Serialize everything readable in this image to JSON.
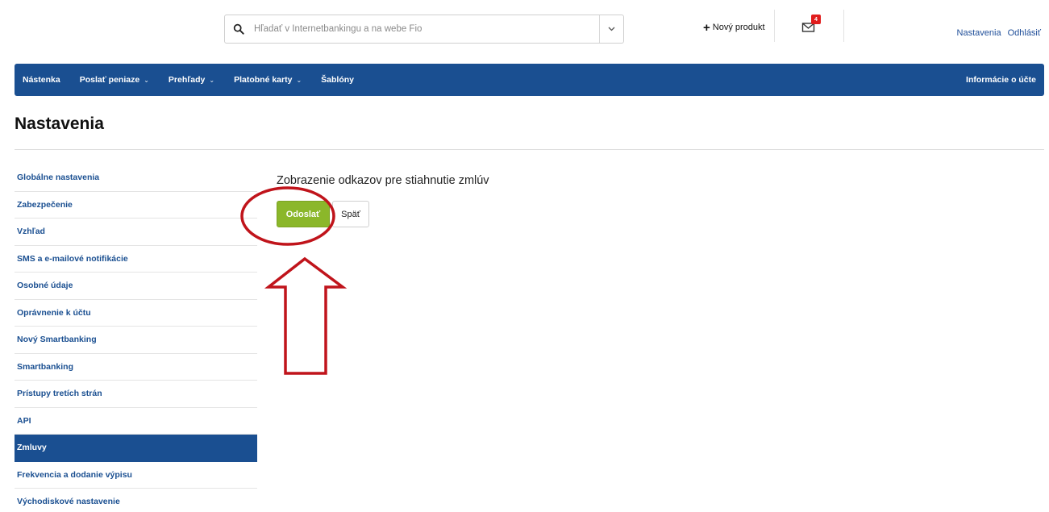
{
  "header": {
    "search": {
      "placeholder": "Hľadať v Internetbankingu a na webe Fio",
      "value": ""
    },
    "new_product": "Nový produkt",
    "messages_badge": "4",
    "links": {
      "settings": "Nastavenia",
      "logout": "Odhlásiť"
    }
  },
  "nav": {
    "items": [
      {
        "label": "Nástenka",
        "dropdown": false
      },
      {
        "label": "Poslať peniaze",
        "dropdown": true
      },
      {
        "label": "Prehľady",
        "dropdown": true
      },
      {
        "label": "Platobné karty",
        "dropdown": true
      },
      {
        "label": "Šablóny",
        "dropdown": false
      }
    ],
    "right": "Informácie o účte",
    "chevron": "⌄"
  },
  "page": {
    "title": "Nastavenia"
  },
  "sidebar": {
    "items": [
      "Globálne nastavenia",
      "Zabezpečenie",
      "Vzhľad",
      "SMS a e-mailové notifikácie",
      "Osobné údaje",
      "Oprávnenie k účtu",
      "Nový Smartbanking",
      "Smartbanking",
      "Prístupy tretích strán",
      "API",
      "Zmluvy",
      "Frekvencia a dodanie výpisu",
      "Východiskové nastavenie"
    ],
    "active_index": 10
  },
  "content": {
    "heading": "Zobrazenie odkazov pre stiahnutie zmlúv",
    "send_label": "Odoslať",
    "back_label": "Späť"
  },
  "colors": {
    "brand_blue": "#1a4f91",
    "send_green": "#8bb72a",
    "annotation_red": "#c0141b",
    "badge_red": "#e11d1d"
  }
}
